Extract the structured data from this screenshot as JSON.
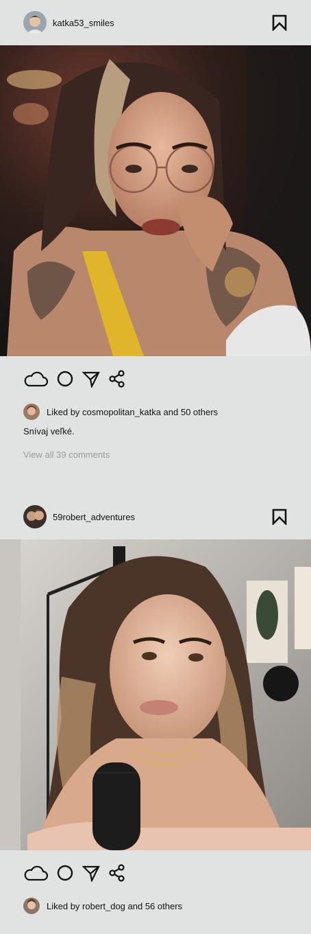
{
  "posts": [
    {
      "username": "katka53_smiles",
      "liked_by_text": "Liked by cosmopolitan_katka and 50 others",
      "caption": "Snívaj veľké.",
      "view_comments": "View all 39 comments",
      "icons": [
        "bookmark-icon",
        "cloud-icon",
        "circle-icon",
        "send-icon",
        "share-icon"
      ]
    },
    {
      "username": "59robert_adventures",
      "liked_by_text": "Liked by robert_dog and 56 others",
      "icons": [
        "bookmark-icon",
        "cloud-icon",
        "circle-icon",
        "send-icon",
        "share-icon"
      ]
    }
  ],
  "colors": {
    "background": "#e1e3e2",
    "text": "#111111",
    "muted": "#9a9a9a"
  }
}
